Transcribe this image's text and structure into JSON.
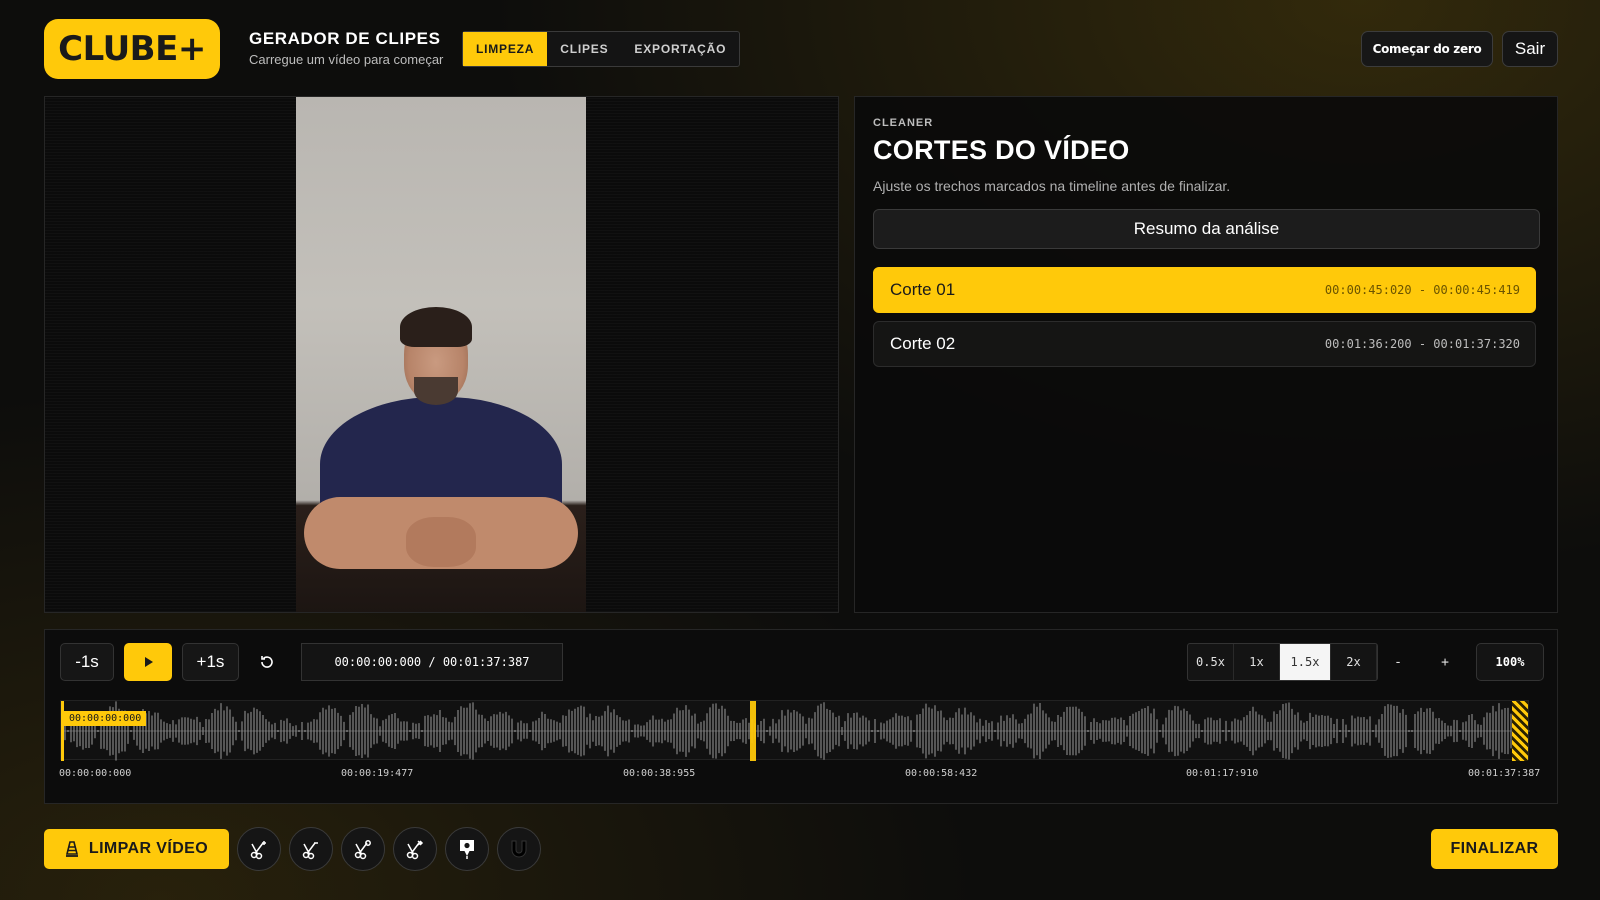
{
  "header": {
    "logo_text": "CLUBE+",
    "title": "GERADOR DE CLIPES",
    "subtitle": "Carregue um vídeo para começar",
    "tabs": [
      {
        "label": "LIMPEZA",
        "active": true
      },
      {
        "label": "CLIPES",
        "active": false
      },
      {
        "label": "EXPORTAÇÃO",
        "active": false
      }
    ],
    "reset_label": "Começar do zero",
    "exit_label": "Sair"
  },
  "panel": {
    "eyebrow": "CLEANER",
    "title": "CORTES DO VÍDEO",
    "description": "Ajuste os trechos marcados na timeline antes de finalizar.",
    "summary_label": "Resumo da análise",
    "cuts": [
      {
        "name": "Corte 01",
        "start": "00:00:45:020",
        "end": "00:00:45:419",
        "range": "00:00:45:020 - 00:00:45:419",
        "active": true
      },
      {
        "name": "Corte 02",
        "start": "00:01:36:200",
        "end": "00:01:37:320",
        "range": "00:01:36:200 - 00:01:37:320",
        "active": false
      }
    ]
  },
  "player": {
    "back_label": "-1s",
    "forward_label": "+1s",
    "play_icon": "play-icon",
    "reset_icon": "rotate-ccw-icon",
    "time_display": "00:00:00:000 / 00:01:37:387",
    "speeds": [
      {
        "label": "0.5x",
        "active": false
      },
      {
        "label": "1x",
        "active": false
      },
      {
        "label": "1.5x",
        "active": true
      },
      {
        "label": "2x",
        "active": false
      }
    ],
    "zoom_out_label": "-",
    "zoom_in_label": "+",
    "zoom_level": "100%"
  },
  "timeline": {
    "playhead_label": "00:00:00:000",
    "ticks": [
      "00:00:00:000",
      "00:00:19:477",
      "00:00:38:955",
      "00:00:58:432",
      "00:01:17:910",
      "00:01:37:387"
    ],
    "accent": "#ffc90a"
  },
  "toolbar": {
    "clean_label": "LIMPAR VÍDEO",
    "clean_icon": "cone-icon",
    "tools": [
      "scissors-plus-icon",
      "scissors-minus-icon",
      "scissors-close-icon",
      "scissors-next-icon",
      "map-pin-icon",
      "magnet-icon"
    ],
    "finish_label": "FINALIZAR"
  }
}
